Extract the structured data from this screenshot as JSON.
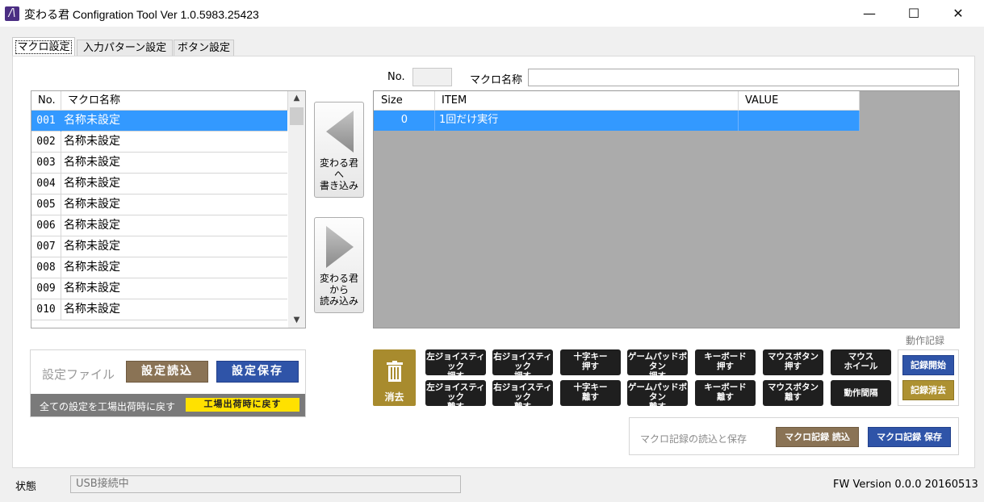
{
  "window": {
    "title": "変わる君 Configration Tool Ver 1.0.5983.25423",
    "minimize": "—",
    "maximize": "☐",
    "close": "✕"
  },
  "tabs": [
    {
      "label": "マクロ設定"
    },
    {
      "label": "入力パターン設定"
    },
    {
      "label": "ボタン設定"
    }
  ],
  "macro_list": {
    "columns": [
      "No.",
      "マクロ名称"
    ],
    "rows": [
      {
        "no": "001",
        "name": "名称未設定"
      },
      {
        "no": "002",
        "name": "名称未設定"
      },
      {
        "no": "003",
        "name": "名称未設定"
      },
      {
        "no": "004",
        "name": "名称未設定"
      },
      {
        "no": "005",
        "name": "名称未設定"
      },
      {
        "no": "006",
        "name": "名称未設定"
      },
      {
        "no": "007",
        "name": "名称未設定"
      },
      {
        "no": "008",
        "name": "名称未設定"
      },
      {
        "no": "009",
        "name": "名称未設定"
      },
      {
        "no": "010",
        "name": "名称未設定"
      }
    ]
  },
  "transfer": {
    "write_label": "変わる君\nへ\n書き込み",
    "read_label": "変わる君\nから\n読み込み"
  },
  "editor": {
    "no_label": "No.",
    "no_value": "",
    "name_label": "マクロ名称",
    "name_value": ""
  },
  "item_grid": {
    "columns": [
      "Size",
      "ITEM",
      "VALUE"
    ],
    "rows": [
      {
        "size": "0",
        "item": "1回だけ実行",
        "value": ""
      }
    ]
  },
  "settings_file": {
    "label": "設定ファイル",
    "load": "設定読込",
    "save": "設定保存",
    "reset_text": "全ての設定を工場出荷時に戻す",
    "reset_button": "工場出荷時に戻す"
  },
  "actions": {
    "delete": "消去",
    "buttons": [
      {
        "top": "左ジョイスティック",
        "bottom": "押す"
      },
      {
        "top": "右ジョイスティック",
        "bottom": "押す"
      },
      {
        "top": "十字キー",
        "bottom": "押す"
      },
      {
        "top": "ゲームパッドボタン",
        "bottom": "押す"
      },
      {
        "top": "キーボード",
        "bottom": "押す"
      },
      {
        "top": "マウスボタン",
        "bottom": "押す"
      },
      {
        "top": "マウス",
        "bottom": "ホイール"
      },
      {
        "top": "左ジョイスティック",
        "bottom": "離す"
      },
      {
        "top": "右ジョイスティック",
        "bottom": "離す"
      },
      {
        "top": "十字キー",
        "bottom": "離す"
      },
      {
        "top": "ゲームパッドボタン",
        "bottom": "離す"
      },
      {
        "top": "キーボード",
        "bottom": "離す"
      },
      {
        "top": "マウスボタン",
        "bottom": "離す"
      },
      {
        "top": "動作間隔",
        "bottom": ""
      }
    ]
  },
  "recording": {
    "title": "動作記録",
    "start": "記録開始",
    "clear": "記録消去"
  },
  "macro_records": {
    "label": "マクロ記録の読込と保存",
    "load": "マクロ記録 読込",
    "save": "マクロ記録 保存"
  },
  "status": {
    "label": "状態",
    "value": "USB接続中",
    "fw_version": "FW Version 0.0.0 20160513"
  },
  "colors": {
    "selection": "#3399ff",
    "brown": "#8a7355",
    "blue": "#2f54a8",
    "gold": "#ad9132",
    "yellow": "#ffe100"
  }
}
